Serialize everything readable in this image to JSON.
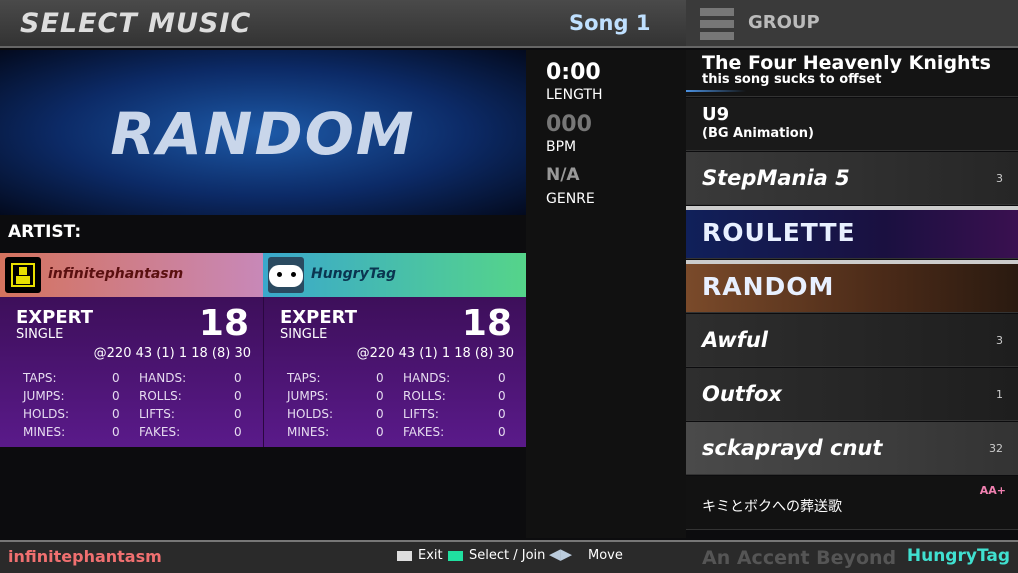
{
  "header": {
    "title": "SELECT MUSIC",
    "song_label": "Song 1",
    "group_label": "GROUP"
  },
  "banner": {
    "text": "RANDOM"
  },
  "artist_label": "ARTIST:",
  "players": [
    {
      "name": "infinitephantasm",
      "difficulty": "EXPERT",
      "style": "SINGLE",
      "meter": "18",
      "tech": "@220 43 (1) 1 18 (8) 30",
      "stats": [
        [
          "TAPS:",
          "0"
        ],
        [
          "JUMPS:",
          "0"
        ],
        [
          "HOLDS:",
          "0"
        ],
        [
          "MINES:",
          "0"
        ],
        [
          "HANDS:",
          "0"
        ],
        [
          "ROLLS:",
          "0"
        ],
        [
          "LIFTS:",
          "0"
        ],
        [
          "FAKES:",
          "0"
        ]
      ]
    },
    {
      "name": "HungryTag",
      "difficulty": "EXPERT",
      "style": "SINGLE",
      "meter": "18",
      "tech": "@220 43 (1) 1 18 (8) 30",
      "stats": [
        [
          "TAPS:",
          "0"
        ],
        [
          "JUMPS:",
          "0"
        ],
        [
          "HOLDS:",
          "0"
        ],
        [
          "MINES:",
          "0"
        ],
        [
          "HANDS:",
          "0"
        ],
        [
          "ROLLS:",
          "0"
        ],
        [
          "LIFTS:",
          "0"
        ],
        [
          "FAKES:",
          "0"
        ]
      ]
    }
  ],
  "info": {
    "length": "0:00",
    "length_label": "LENGTH",
    "bpm": "000",
    "bpm_label": "BPM",
    "genre": "N/A",
    "genre_label": "GENRE"
  },
  "wheel": [
    {
      "title": "The Four Heavenly Knights",
      "subtitle": "this song sucks to offset"
    },
    {
      "title": "U9",
      "subtitle": "(BG Animation)"
    },
    {
      "title": "StepMania 5",
      "count": "3"
    },
    {
      "title": "ROULETTE"
    },
    {
      "title": "RANDOM"
    },
    {
      "title": "Awful",
      "count": "3"
    },
    {
      "title": "Outfox",
      "count": "1"
    },
    {
      "title": "sckaprayd cnut",
      "count": "32"
    },
    {
      "title": "キミとボクへの葬送歌",
      "grade": "AA+"
    },
    {
      "title": "An Accent Beyond"
    }
  ],
  "footer": {
    "p1": "infinitephantasm",
    "p2": "HungryTag",
    "exit": "Exit",
    "select": "Select / Join",
    "move": "Move"
  },
  "colors": {
    "p1": "#f07070",
    "p2": "#40e0d0",
    "panel": "#4a1470",
    "select_key": "#20e0a0"
  }
}
